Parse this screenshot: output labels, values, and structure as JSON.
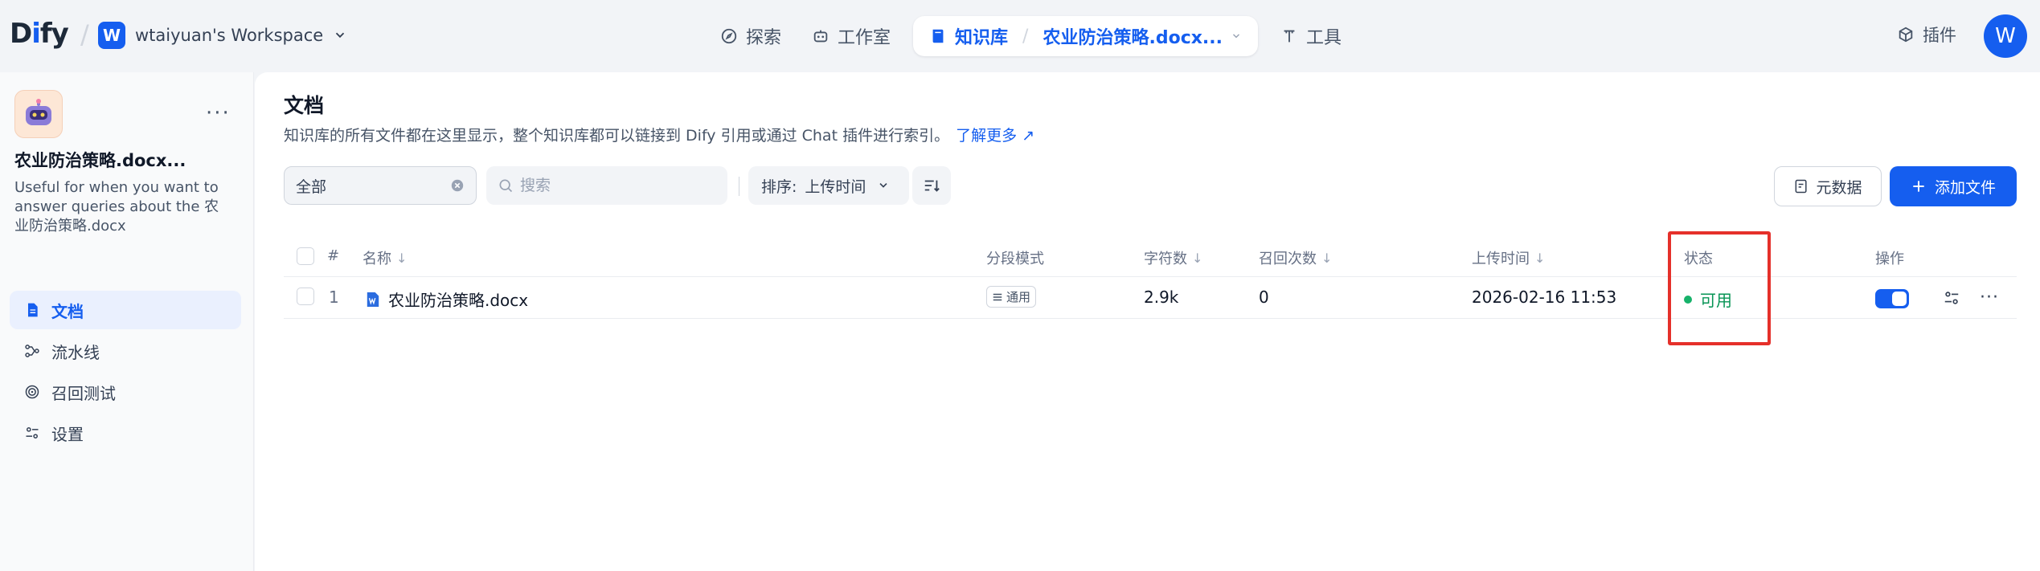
{
  "topbar": {
    "logo_pre": "D",
    "logo_i": "i",
    "logo_post": "fy",
    "workspace_initial": "W",
    "workspace_name": "wtaiyuan's Workspace",
    "nav": [
      {
        "label": "探索",
        "icon": "compass-icon"
      },
      {
        "label": "工作室",
        "icon": "robot-icon"
      }
    ],
    "active_nav": {
      "label": "知识库",
      "breadcrumb": "农业防治策略.docx...",
      "icon": "book-icon"
    },
    "tools_label": "工具",
    "plugin_label": "插件",
    "user_initial": "W"
  },
  "sidebar": {
    "dataset_name": "农业防治策略.docx...",
    "dataset_desc": "Useful for when you want to answer queries about the 农业防治策略.docx",
    "more": "···",
    "items": [
      {
        "label": "文档",
        "icon": "document-icon",
        "active": true
      },
      {
        "label": "流水线",
        "icon": "pipeline-icon",
        "active": false
      },
      {
        "label": "召回测试",
        "icon": "target-icon",
        "active": false
      },
      {
        "label": "设置",
        "icon": "settings-icon",
        "active": false
      }
    ]
  },
  "main": {
    "title": "文档",
    "description": "知识库的所有文件都在这里显示，整个知识库都可以链接到 Dify 引用或通过 Chat 插件进行索引。",
    "learn_more": "了解更多",
    "filter_value": "全部",
    "search_placeholder": "搜索",
    "sort_label": "排序:",
    "sort_value": "上传时间",
    "metadata_button": "元数据",
    "add_file_button": "添加文件"
  },
  "table": {
    "columns": {
      "index": "#",
      "name": "名称",
      "mode": "分段模式",
      "chars": "字符数",
      "recall": "召回次数",
      "upload_time": "上传时间",
      "status": "状态",
      "actions": "操作"
    },
    "rows": [
      {
        "index": "1",
        "name": "农业防治策略.docx",
        "mode": "通用",
        "chars": "2.9k",
        "recall": "0",
        "upload_time": "2026-02-16 11:53",
        "status": "可用",
        "enabled": true
      }
    ]
  },
  "colors": {
    "accent": "#155eef",
    "status_green": "#17b26a",
    "highlight": "#e5302a"
  }
}
